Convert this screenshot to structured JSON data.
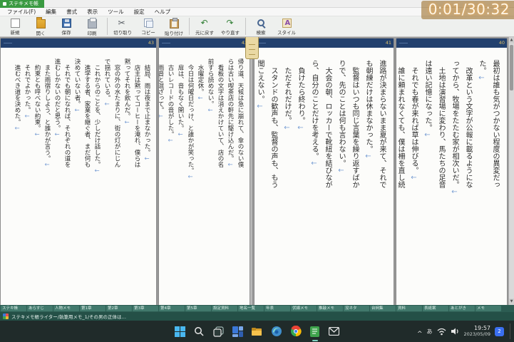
{
  "window": {
    "app_title": "ステキメモ帳"
  },
  "overlay": {
    "timer_text": "0:01/30:32"
  },
  "menu": {
    "items": [
      "ファイル(F)",
      "編集",
      "書式",
      "表示",
      "ツール",
      "設定",
      "ヘルプ"
    ]
  },
  "toolbar": {
    "groups": [
      {
        "buttons": [
          {
            "label": "新規",
            "icon": "ic-new",
            "icon_name": "new-file-icon"
          },
          {
            "label": "開く",
            "icon": "ic-open",
            "icon_name": "open-folder-icon"
          },
          {
            "label": "保存",
            "icon": "ic-save",
            "icon_name": "save-icon"
          },
          {
            "label": "印刷",
            "icon": "ic-print",
            "icon_name": "print-icon"
          }
        ]
      },
      {
        "buttons": [
          {
            "label": "切り取り",
            "icon": "ic-cut",
            "icon_name": "cut-icon"
          },
          {
            "label": "コピー",
            "icon": "ic-copy",
            "icon_name": "copy-icon"
          },
          {
            "label": "貼り付け",
            "icon": "ic-paste",
            "icon_name": "paste-icon"
          }
        ]
      },
      {
        "buttons": [
          {
            "label": "元に戻す",
            "icon": "ic-undo",
            "icon_name": "undo-icon"
          },
          {
            "label": "やり直す",
            "icon": "ic-redo",
            "icon_name": "redo-icon"
          }
        ]
      },
      {
        "buttons": [
          {
            "label": "検索",
            "icon": "ic-search",
            "icon_name": "search-icon"
          },
          {
            "label": "スタイル",
            "icon": "ic-style",
            "icon_name": "style-icon"
          }
        ]
      }
    ]
  },
  "document": {
    "panes": [
      {
        "side": "left",
        "pages": [
          {
            "number": "43",
            "lines": [
              "　結局、雨は夜まで止まなかった。←",
              "　店主は黙ってコーヒーを淹れ、僕らは",
              "黙ってそれを飲んだ。←",
              "　窓の外の水たまりに、街の灯がにじん",
              "で揺れている。←",
              "　これからのことを、少しだけ話した。←",
              "　進学する者、家業を継ぐ者、まだ何も",
              "決めていない者。←",
              "　それでも朝になれば、それぞれの道を",
              "進むしかないのだと思う。←",
              "　また雨宿りしよう、と誰かが言う。←",
              "　約束とも呼べない約束。←",
              "　それでよかった。←",
              "　進むべき道を決めた。←"
            ]
          },
          {
            "number": "42",
            "lines": [
              "帰り道、天候は急に崩れて、傘のない僕",
              "らは古い喫茶店の軒先に駆け込んだ。←",
              "　看板の文字は消えかけていて、店の名",
              "前すら読めない。←",
              "　水曜定休。←",
              "　今日は何曜日だっけ、と誰かが笑った。←",
              "　扉は、音もなく開いた。←",
              "　古いレコードの音がした。←",
              "　雨音と混ざって。←"
            ]
          }
        ]
      },
      {
        "side": "right",
        "pages": [
          {
            "number": "41",
            "lines": [
              "進路が決まらないまま夏が来て、それで",
              "も朝練だけは休まなかった。←",
              "　監督はいつも同じ言葉を繰り返すばか",
              "りで、先のことは何も言わない。←",
              "　大会の朝、ロッカーで靴紐を結びなが",
              "ら、自分のことだけを考える。←",
              "　負けたら終わり。←",
              "　ただそれだけだ。←",
              "　スタンドの歓声も、監督の声も、もう",
              "聞こえない。←"
            ]
          },
          {
            "number": "40",
            "lines": [
              "最初は誰も気がつかない程度の異変だっ",
              "た。←",
              "　改革という文字が公報に載るようにな",
              "ってから、牧場をたたむ家が相次いだ。←",
              "　土地は演習場に変わり、馬たちの足音",
              "は遠い記憶になった。←",
              "　それでも春が来れば草は伸びる。←",
              "　誰に頼まれなくても、僕は柵を直し続",
              "けた。←"
            ]
          }
        ]
      }
    ]
  },
  "doc_tabs": {
    "items": [
      "ステキ帳",
      "あらすじ",
      "人物メモ",
      "第1章",
      "第2章",
      "第3章",
      "第4章",
      "第5章",
      "設定資料",
      "地名一覧",
      "年表",
      "伏線メモ",
      "推敲メモ",
      "没ネタ",
      "台詞集",
      "資料",
      "表紙案",
      "あとがき",
      "メモ"
    ]
  },
  "statusbar": {
    "active_title": "ステキメモ帳ライター/執筆用メモ_1/その男の正体は…"
  },
  "taskbar": {
    "tray": {
      "ime": "あ",
      "time": "19:57",
      "date": "2023/05/09",
      "badge": "2"
    }
  }
}
